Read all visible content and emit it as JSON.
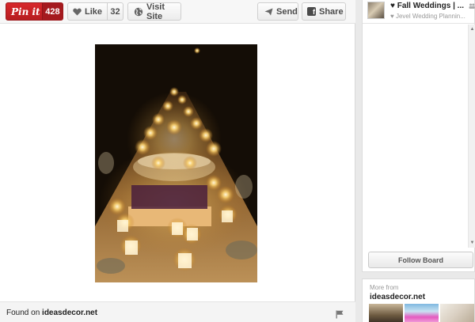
{
  "toolbar": {
    "pinit_label": "Pin it",
    "pinit_count": "428",
    "like_label": "Like",
    "like_count": "32",
    "visit_label": "Visit Site",
    "send_label": "Send",
    "share_label": "Share"
  },
  "footer": {
    "found_prefix": "Found on",
    "found_site": "ideasdecor.net"
  },
  "board": {
    "title": "♥ Fall Weddings | ...",
    "owner": "♥ Jevel Wedding Plannin...",
    "follow_label": "Follow Board"
  },
  "more": {
    "label": "More from",
    "site": "ideasdecor.net"
  },
  "colors": {
    "pinit_red": "#c8232c",
    "candle_glow": "#f6c66a"
  },
  "icons": [
    "heart-icon",
    "globe-icon",
    "send-icon",
    "facebook-icon",
    "flag-icon",
    "people-icon"
  ]
}
